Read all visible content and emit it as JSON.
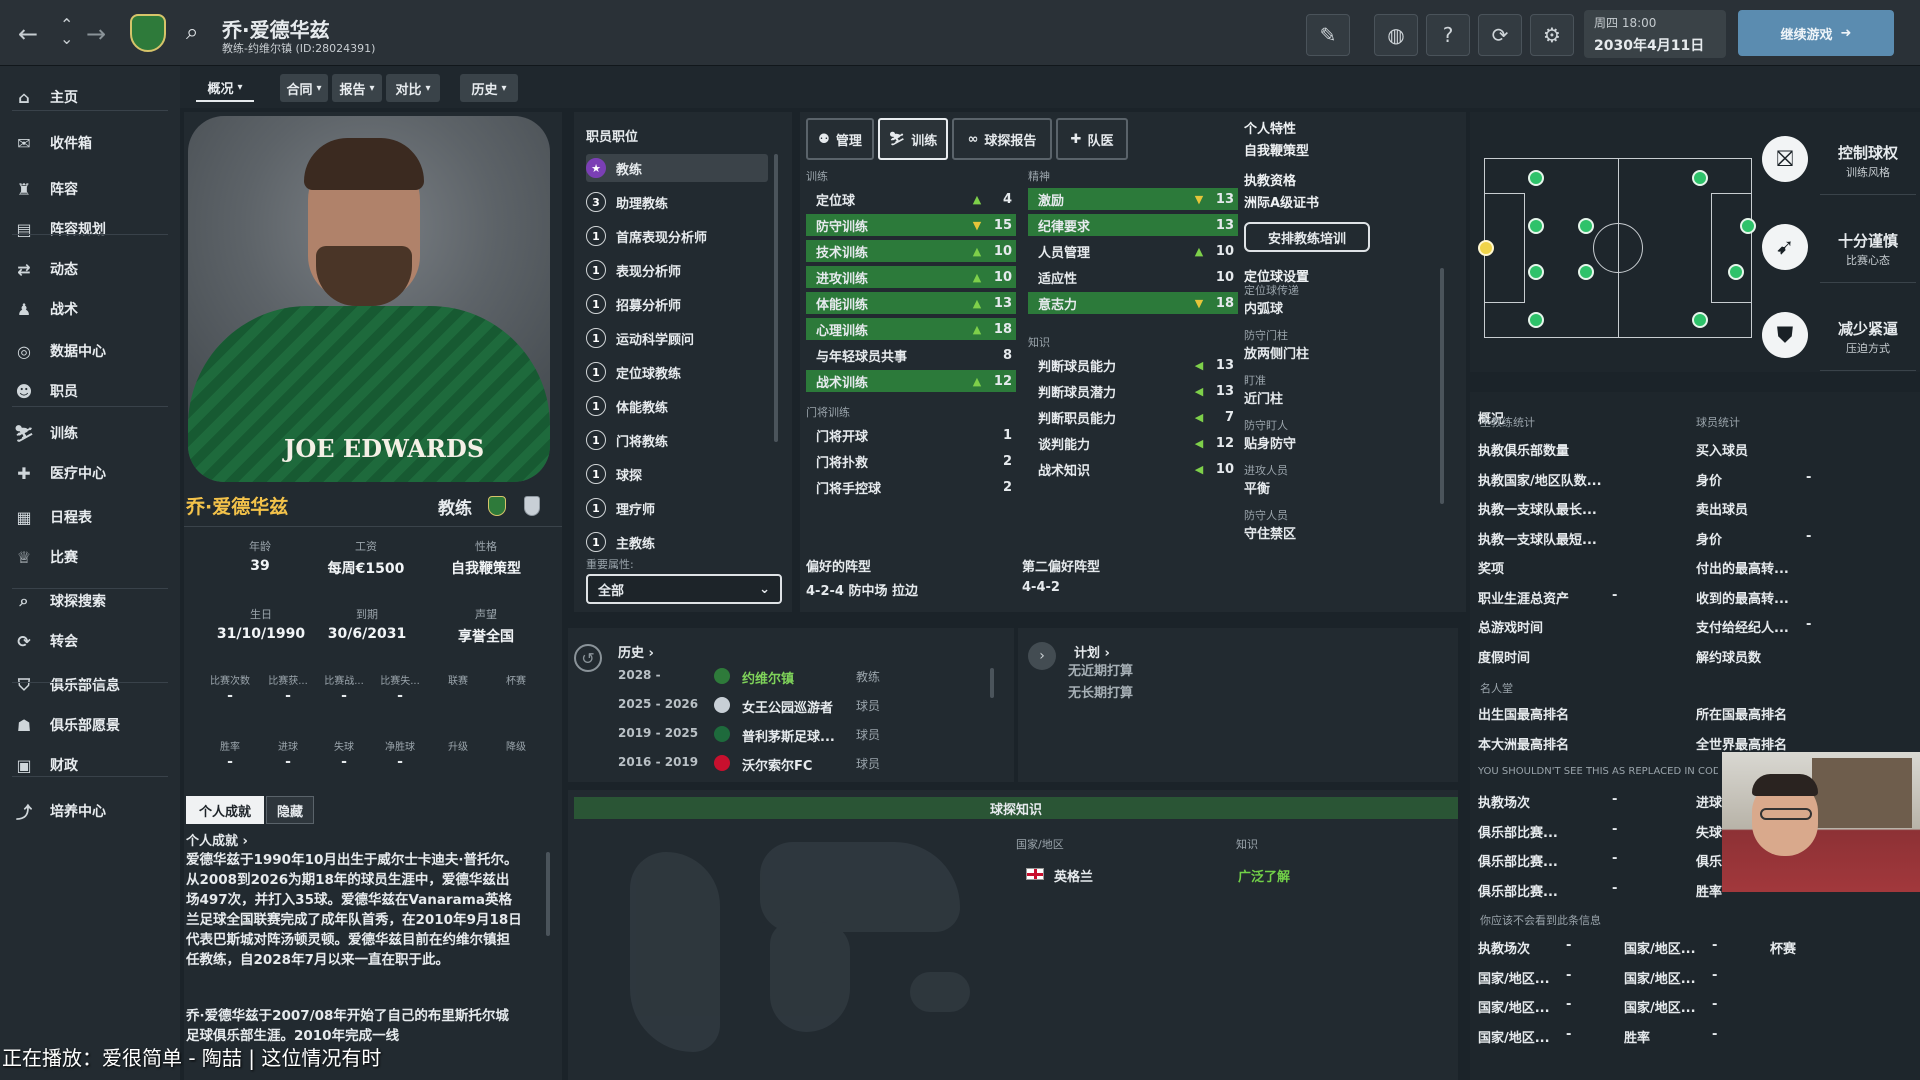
{
  "top": {
    "name": "乔·爱德华兹",
    "sub": "教练-约维尔镇 (ID:28024391)",
    "date_day": "周四 18:00",
    "date": "2030年4月11日",
    "continue": "继续游戏"
  },
  "sidebar": [
    "主页",
    "收件箱",
    "阵容",
    "阵容规划",
    "动态",
    "战术",
    "数据中心",
    "职员",
    "训练",
    "医疗中心",
    "日程表",
    "比赛",
    "球探搜索",
    "转会",
    "俱乐部信息",
    "俱乐部愿景",
    "财政",
    "培养中心"
  ],
  "subtabs": [
    "概况",
    "合同",
    "报告",
    "对比",
    "历史"
  ],
  "profile": {
    "name": "乔·爱德华兹",
    "role": "教练",
    "kit_text": "JOE EDWARDS",
    "age_l": "年龄",
    "age": "39",
    "wage_l": "工资",
    "wage": "每周€1500",
    "pers_l": "性格",
    "pers": "自我鞭策型",
    "dob_l": "生日",
    "dob": "31/10/1990",
    "exp_l": "到期",
    "exp": "30/6/2031",
    "rep_l": "声望",
    "rep": "享誉全国",
    "stats1": [
      "比赛次数",
      "比赛获...",
      "比赛战...",
      "比赛失...",
      "联赛",
      "杯赛"
    ],
    "stats1v": [
      "-",
      "-",
      "-",
      "-",
      "",
      ""
    ],
    "stats2": [
      "胜率",
      "进球",
      "失球",
      "净胜球",
      "升级",
      "降级"
    ],
    "stats2v": [
      "-",
      "-",
      "-",
      "-",
      "",
      ""
    ]
  },
  "bio": {
    "tab1": "个人成就",
    "tab2": "隐藏",
    "head": "个人成就 ›",
    "text": "爱德华兹于1990年10月出生于威尔士卡迪夫·普托尔。从2008到2026为期18年的球员生涯中，爱德华兹出场497次，并打入35球。爱德华兹在Vanarama英格兰足球全国联赛完成了成年队首秀，在2010年9月18日代表巴斯城对阵汤顿灵顿。爱德华兹目前在约维尔镇担任教练，自2028年7月以来一直在职于此。",
    "text2": "乔·爱德华兹于2007/08年开始了自己的布里斯托尔城足球俱乐部生涯。2010年完成一线",
    "overlay": "正在播放：爱很简单 - 陶喆 | 这位情况有时"
  },
  "roles": {
    "title": "职员职位",
    "items": [
      [
        "★",
        "教练"
      ],
      [
        "3",
        "助理教练"
      ],
      [
        "1",
        "首席表现分析师"
      ],
      [
        "1",
        "表现分析师"
      ],
      [
        "1",
        "招募分析师"
      ],
      [
        "1",
        "运动科学顾问"
      ],
      [
        "1",
        "定位球教练"
      ],
      [
        "1",
        "体能教练"
      ],
      [
        "1",
        "门将教练"
      ],
      [
        "1",
        "球探"
      ],
      [
        "1",
        "理疗师"
      ],
      [
        "1",
        "主教练"
      ]
    ],
    "filter_label": "重要属性:",
    "filter": "全部"
  },
  "tabs": [
    "管理",
    "训练",
    "球探报告",
    "队医"
  ],
  "train": {
    "h": "训练",
    "items": [
      [
        "定位球",
        "4",
        0,
        "▲"
      ],
      [
        "防守训练",
        "15",
        1,
        "▼"
      ],
      [
        "技术训练",
        "10",
        1,
        "▲"
      ],
      [
        "进攻训练",
        "10",
        1,
        "▲"
      ],
      [
        "体能训练",
        "13",
        1,
        "▲"
      ],
      [
        "心理训练",
        "18",
        1,
        "▲"
      ],
      [
        "与年轻球员共事",
        "8",
        0,
        ""
      ],
      [
        "战术训练",
        "12",
        1,
        "▲"
      ]
    ],
    "gk_h": "门将训练",
    "gk": [
      [
        "门将开球",
        "1"
      ],
      [
        "门将扑救",
        "2"
      ],
      [
        "门将手控球",
        "2"
      ]
    ]
  },
  "mental": {
    "h": "精神",
    "items": [
      [
        "激励",
        "13",
        1,
        "▼"
      ],
      [
        "纪律要求",
        "13",
        1,
        ""
      ],
      [
        "人员管理",
        "10",
        0,
        "▲"
      ],
      [
        "适应性",
        "10",
        0,
        ""
      ],
      [
        "意志力",
        "18",
        1,
        "▼"
      ]
    ],
    "k_h": "知识",
    "k": [
      [
        "判断球员能力",
        "13"
      ],
      [
        "判断球员潜力",
        "13"
      ],
      [
        "判断职员能力",
        "7"
      ],
      [
        "谈判能力",
        "12"
      ],
      [
        "战术知识",
        "10"
      ]
    ]
  },
  "pref": {
    "l1": "偏好的阵型",
    "v1": "4-2-4 防中场 拉边",
    "l2": "第二偏好阵型",
    "v2": "4-4-2"
  },
  "traits": {
    "h": "个人特性",
    "v": "自我鞭策型",
    "q_h": "执教资格",
    "q": "洲际A级证书",
    "btn": "安排教练培训",
    "sp_h": "定位球设置",
    "list": [
      [
        "定位球传递",
        "内弧球"
      ],
      [
        "防守门柱",
        "放两侧门柱"
      ],
      [
        "盯准",
        "近门柱"
      ],
      [
        "防守盯人",
        "贴身防守"
      ],
      [
        "进攻人员",
        "平衡"
      ],
      [
        "防守人员",
        "守住禁区"
      ]
    ]
  },
  "style": [
    [
      "控制球权",
      "训练风格"
    ],
    [
      "十分谨慎",
      "比赛心态"
    ],
    [
      "减少紧逼",
      "压迫方式"
    ]
  ],
  "history": {
    "h": "历史 ›",
    "rows": [
      [
        "2028 -",
        "约维尔镇",
        "教练"
      ],
      [
        "2025 - 2026",
        "女王公园巡游者",
        "球员"
      ],
      [
        "2019 - 2025",
        "普利茅斯足球...",
        "球员"
      ],
      [
        "2016 - 2019",
        "沃尔索尔FC",
        "球员"
      ]
    ],
    "plan_h": "计划 ›",
    "plan1": "无近期打算",
    "plan2": "无长期打算"
  },
  "scout": {
    "h": "球探知识",
    "c1": "国家/地区",
    "c2": "知识",
    "country": "英格兰",
    "level": "广泛了解"
  },
  "overview": {
    "h": "概况",
    "c1h": "主教练统计",
    "c2h": "球员统计",
    "rows": [
      [
        "执教俱乐部数量",
        "",
        "买入球员",
        ""
      ],
      [
        "执教国家/地区队数...",
        "",
        "身价",
        "-"
      ],
      [
        "执教一支球队最长...",
        "",
        "卖出球员",
        ""
      ],
      [
        "执教一支球队最短...",
        "",
        "身价",
        "-"
      ],
      [
        "奖项",
        "",
        "付出的最高转...",
        ""
      ],
      [
        "职业生涯总资产",
        "-",
        "收到的最高转...",
        ""
      ],
      [
        "总游戏时间",
        "",
        "支付给经纪人...",
        "-"
      ],
      [
        "度假时间",
        "",
        "解约球员数",
        ""
      ]
    ],
    "hof": "名人堂",
    "r2": [
      [
        "出生国最高排名",
        "",
        "所在国最高排名",
        ""
      ],
      [
        "本大洲最高排名",
        "",
        "全世界最高排名",
        ""
      ]
    ],
    "warn": "YOU SHOULDN'T SEE THIS AS REPLACED IN CODE",
    "r3": [
      [
        "执教场次",
        "-",
        "进球",
        "-"
      ],
      [
        "俱乐部比赛...",
        "-",
        "失球",
        "-"
      ],
      [
        "俱乐部比赛...",
        "-",
        "俱乐部净胜...",
        "-"
      ],
      [
        "俱乐部比赛...",
        "-",
        "胜率",
        "-"
      ]
    ],
    "note": "你应该不会看到此条信息",
    "r4": [
      [
        "执教场次",
        "-",
        "国家/地区...",
        "-",
        "杯赛"
      ],
      [
        "国家/地区...",
        "-",
        "国家/地区...",
        "-",
        ""
      ],
      [
        "国家/地区...",
        "-",
        "国家/地区...",
        "-",
        ""
      ],
      [
        "国家/地区...",
        "-",
        "胜率",
        "-",
        ""
      ]
    ]
  },
  "colors": {
    "green": "#2c7a3a",
    "accent": "#2ec26a"
  }
}
